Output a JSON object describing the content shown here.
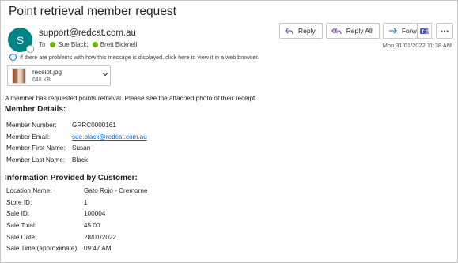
{
  "message": {
    "subject": "Point retrieval member request",
    "avatar_initial": "S",
    "sender": "support@redcat.com.au",
    "to_label": "To",
    "recipients": [
      "Sue Black;",
      "Brett Bicknell"
    ],
    "date": "Mon 31/01/2022 11:38 AM",
    "info_text": "If there are problems with how this message is displayed, click here to view it in a web browser."
  },
  "actions": {
    "reply": "Reply",
    "reply_all": "Reply All",
    "forward": "Forward"
  },
  "attachment": {
    "name": "receipt.jpg",
    "size": "648 KB"
  },
  "body": {
    "intro": "A member has requested points retrieval. Please see the attached photo of their receipt.",
    "member_title": "Member Details:",
    "member_rows": [
      {
        "label": "Member Number:",
        "value": "GRRC0000161"
      },
      {
        "label": "Member Email:",
        "value": "sue.black@redcat.com.au"
      },
      {
        "label": "Member First Name:",
        "value": "Susan"
      },
      {
        "label": "Member Last Name:",
        "value": "Black"
      }
    ],
    "customer_title": "Information Provided by Customer:",
    "customer_rows": [
      {
        "label": "Location Name:",
        "value": "Gato Rojo - Cremorne"
      },
      {
        "label": "Store ID:",
        "value": "1"
      },
      {
        "label": "Sale ID:",
        "value": "100004"
      },
      {
        "label": "Sale Total:",
        "value": "45.00"
      },
      {
        "label": "Sale Date:",
        "value": "28/01/2022"
      },
      {
        "label": "Sale Time (approximate):",
        "value": "09:47 AM"
      }
    ]
  },
  "colors": {
    "avatar": "#038387",
    "presence": "#6bb700",
    "link": "#0563c1",
    "accent": "#0f6cbd"
  }
}
